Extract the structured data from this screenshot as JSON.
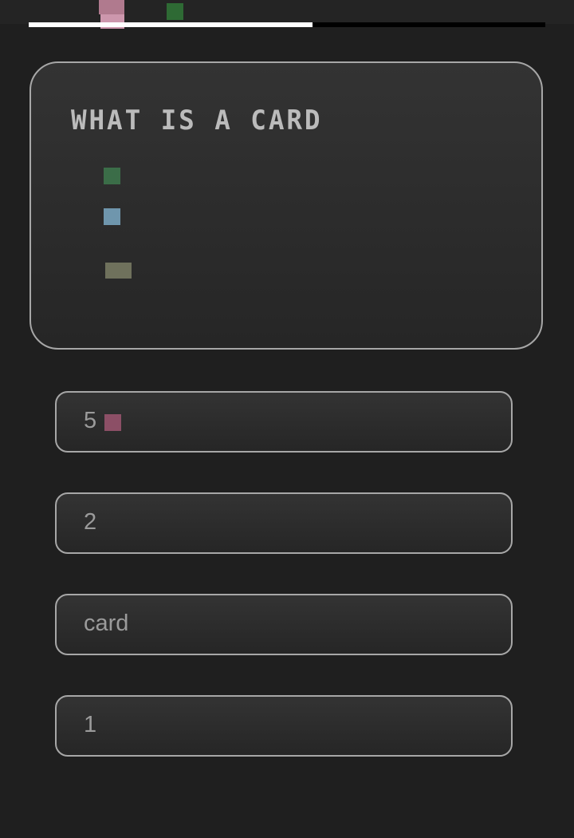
{
  "progress": {
    "value": 0.55
  },
  "question": {
    "title": "WHAT IS A CARD"
  },
  "options": [
    {
      "label": "5"
    },
    {
      "label": "2"
    },
    {
      "label": "card"
    },
    {
      "label": "1"
    }
  ],
  "colors": {
    "background": "#1f1f1f",
    "card_border": "#a7a7a7",
    "text": "#9b9b9b"
  }
}
